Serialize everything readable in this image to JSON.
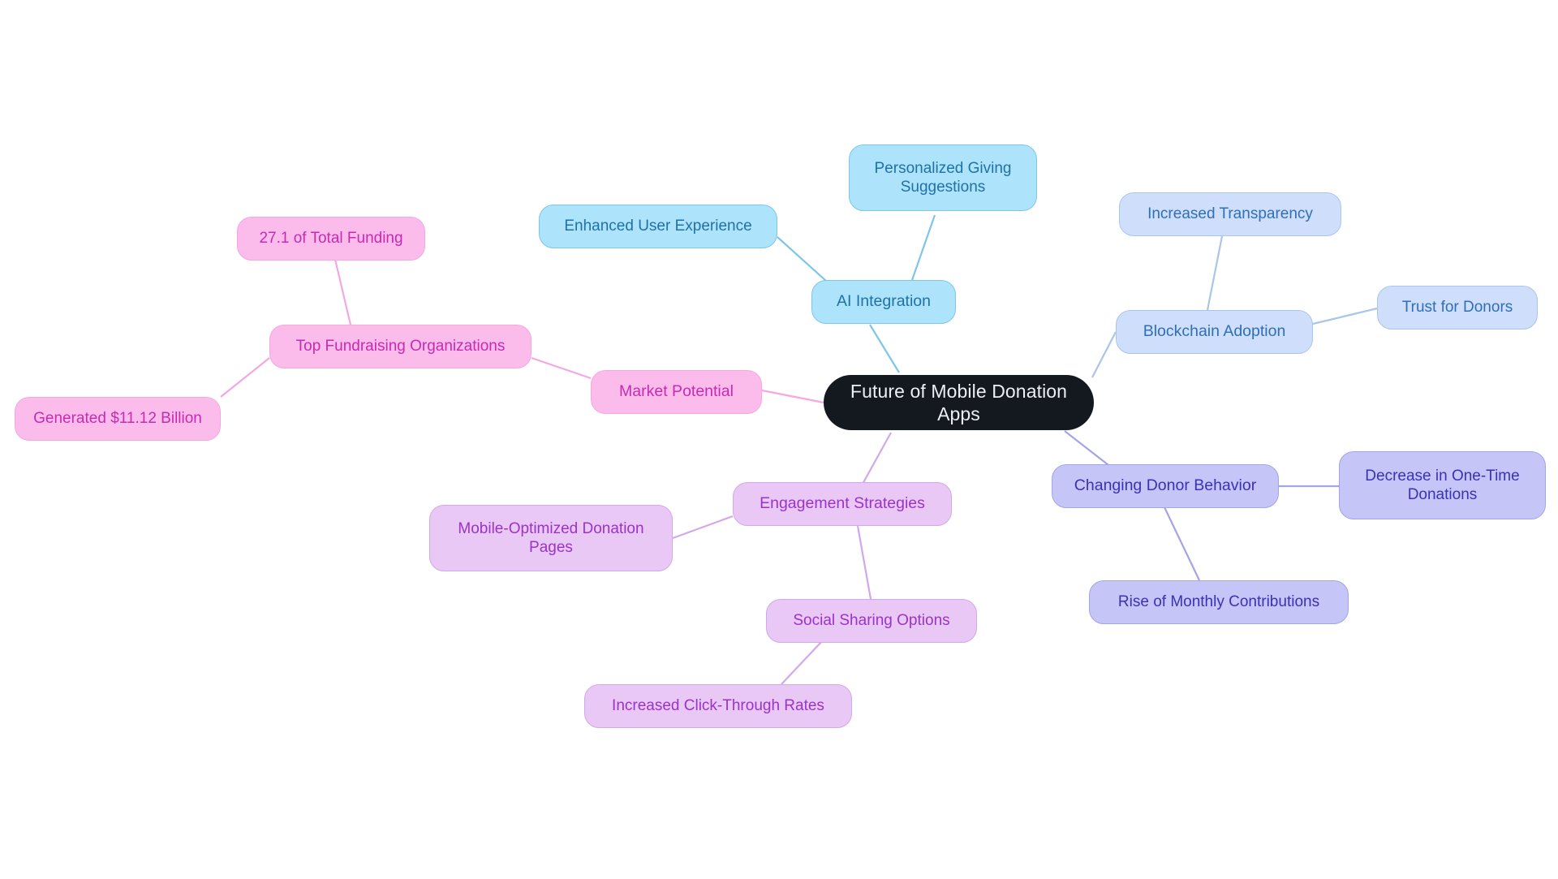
{
  "diagram": {
    "type": "mindmap",
    "title": "Future of Mobile Donation Apps",
    "background": "#ffffff"
  },
  "palette": {
    "root_fill": "#14181f",
    "root_text": "#eceff3",
    "pink_fill": "#fbbcec",
    "pink_text": "#c82bb0",
    "pink_border": "#f3a8e2",
    "blue_fill": "#ade3fb",
    "blue_text": "#1f72a8",
    "blue_border": "#7ec6e8",
    "paleblue_fill": "#cfdffb",
    "paleblue_text": "#2e6fb8",
    "paleblue_border": "#a8c6ea",
    "periwinkle_fill": "#c5c6f7",
    "periwinkle_text": "#3a32b5",
    "periwinkle_border": "#a3a5e4",
    "violet_fill": "#e9c8f5",
    "violet_text": "#9b33c8",
    "violet_border": "#d3a8e8"
  },
  "nodes": {
    "root": {
      "label": "Future of Mobile Donation Apps"
    },
    "market_potential": {
      "label": "Market Potential"
    },
    "top_fundraising": {
      "label": "Top Fundraising Organizations"
    },
    "pct_total_funding": {
      "label": "27.1 of Total Funding"
    },
    "generated_billion": {
      "label": "Generated $11.12 Billion"
    },
    "ai_integration": {
      "label": "AI Integration"
    },
    "enhanced_ux": {
      "label": "Enhanced User Experience"
    },
    "personalized_giving": {
      "label": "Personalized Giving\nSuggestions"
    },
    "blockchain_adoption": {
      "label": "Blockchain Adoption"
    },
    "increased_transparency": {
      "label": "Increased Transparency"
    },
    "trust_for_donors": {
      "label": "Trust for Donors"
    },
    "changing_donor_behavior": {
      "label": "Changing Donor Behavior"
    },
    "decrease_one_time": {
      "label": "Decrease in One-Time\nDonations"
    },
    "rise_monthly": {
      "label": "Rise of Monthly Contributions"
    },
    "engagement_strategies": {
      "label": "Engagement Strategies"
    },
    "mobile_optimized": {
      "label": "Mobile-Optimized Donation\nPages"
    },
    "social_sharing": {
      "label": "Social Sharing Options"
    },
    "increased_ctr": {
      "label": "Increased Click-Through Rates"
    }
  },
  "branches": [
    {
      "name": "Market Potential",
      "color": "#f3a8e2",
      "children": [
        "Top Fundraising Organizations",
        "27.1 of Total Funding",
        "Generated $11.12 Billion"
      ]
    },
    {
      "name": "AI Integration",
      "color": "#7ec6e8",
      "children": [
        "Enhanced User Experience",
        "Personalized Giving Suggestions"
      ]
    },
    {
      "name": "Blockchain Adoption",
      "color": "#a8c6ea",
      "children": [
        "Increased Transparency",
        "Trust for Donors"
      ]
    },
    {
      "name": "Changing Donor Behavior",
      "color": "#a3a5e4",
      "children": [
        "Decrease in One-Time Donations",
        "Rise of Monthly Contributions"
      ]
    },
    {
      "name": "Engagement Strategies",
      "color": "#d3a8e8",
      "children": [
        "Mobile-Optimized Donation Pages",
        "Social Sharing Options",
        "Increased Click-Through Rates"
      ]
    }
  ]
}
